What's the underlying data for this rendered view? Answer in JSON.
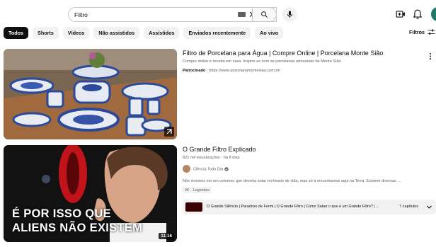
{
  "search": {
    "query": "Filtro"
  },
  "chips": [
    {
      "label": "Todos",
      "active": true
    },
    {
      "label": "Shorts",
      "active": false
    },
    {
      "label": "Vídeos",
      "active": false
    },
    {
      "label": "Não assistidos",
      "active": false
    },
    {
      "label": "Assistidos",
      "active": false
    },
    {
      "label": "Enviados recentemente",
      "active": false
    },
    {
      "label": "Ao vivo",
      "active": false
    }
  ],
  "filters_label": "Filtros",
  "ad": {
    "title": "Filtro de Porcelana para Água | Compre Online | Porcelana Monte Sião",
    "description": "Compre online e receba em casa. Inspire-se com as porcelanas artesanais de Monte Sião.",
    "sponsored_label": "Patrocinado",
    "url": " · https://www.porcelanamontesiao.com.br/"
  },
  "video": {
    "title": "O Grande Filtro Explicado",
    "views": "821 mil visualizações",
    "age": "há 8 dias",
    "channel": "Ciência Todo Dia",
    "description": "Nós vivemos em um universo que deveria estar recheado de vida, mas só a encontramos aqui na Terra. Existem diversas ...",
    "badges": [
      "4K",
      "Legendas"
    ],
    "duration": "11:16",
    "thumb_caption_1": "É POR ISSO QUE",
    "thumb_caption_2": "ALIENS NÃO EXISTEM",
    "chapters_text": "O Grande Silêncio | Paradoxo de Fermi | O Grande Filtro | Como Saber o que é um Grande Filtro? | ...",
    "chapters_count": "7 capítulos"
  },
  "icons": {
    "search": "search-icon",
    "mic": "mic-icon",
    "clear": "close-icon",
    "keyboard": "keyboard-icon",
    "create": "create-video-icon",
    "bell": "bell-icon",
    "filters": "sliders-icon",
    "more": "more-vert-icon",
    "verified": "verified-check-icon",
    "external": "external-link-icon",
    "chevron": "chevron-down-icon"
  }
}
